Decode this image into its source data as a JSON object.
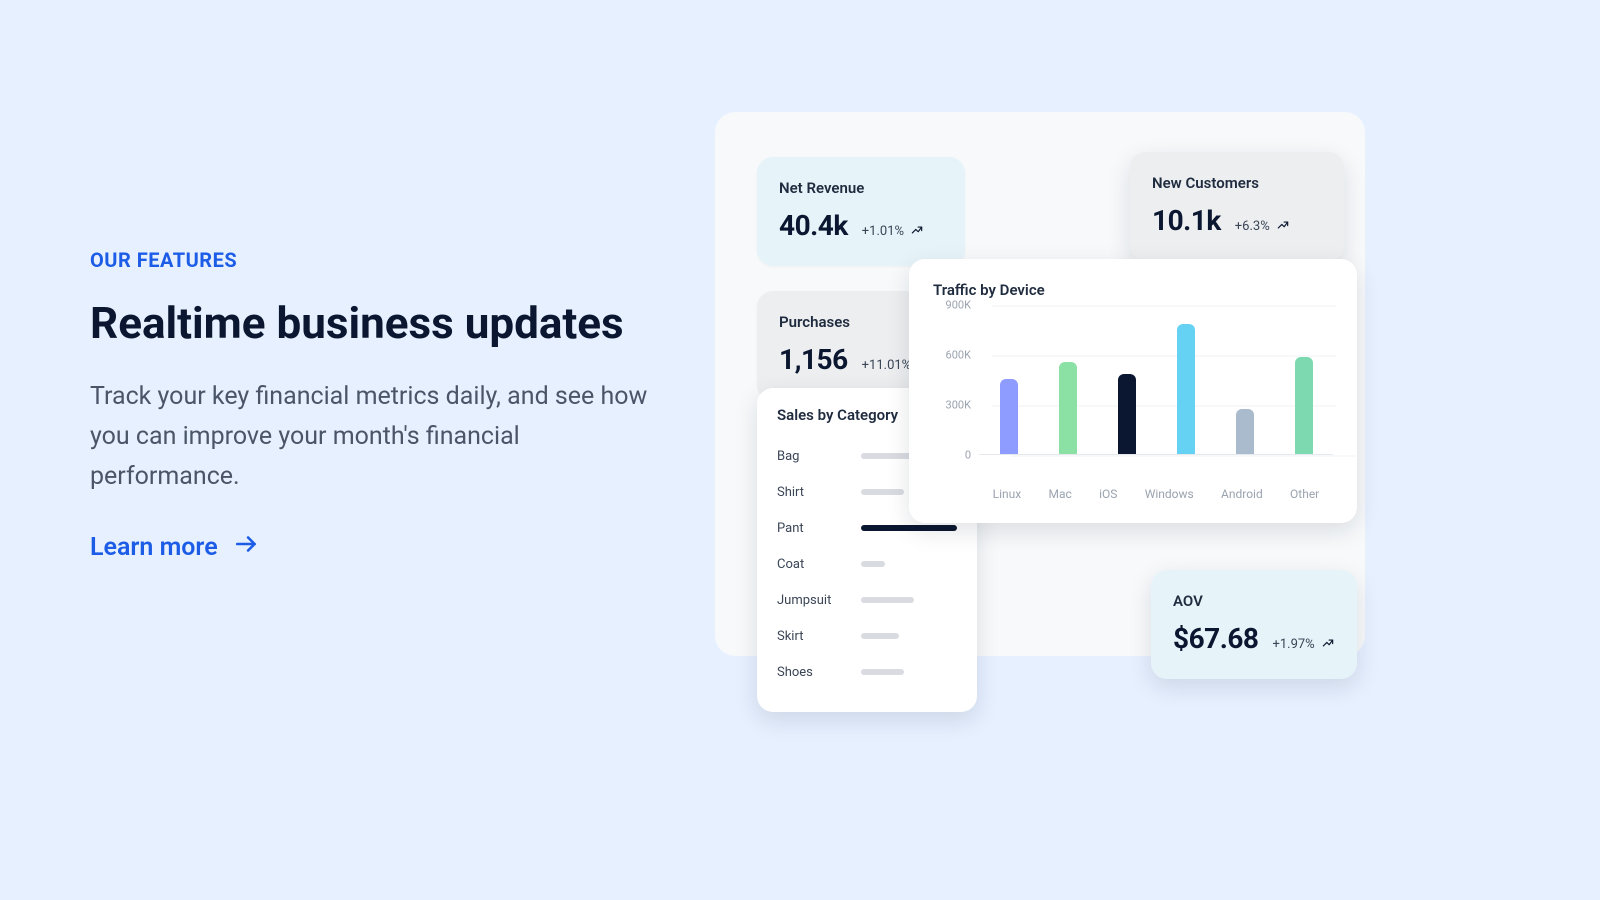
{
  "left": {
    "eyebrow": "OUR FEATURES",
    "headline": "Realtime business updates",
    "body": "Track your key financial metrics daily, and see how you can improve your month's financial performance.",
    "cta": "Learn more"
  },
  "colors": {
    "accent": "#1C5CE6",
    "page_bg": "#E6F0FF",
    "panel_bg": "#F7F9FB",
    "card_cyan": "#E6F4F9",
    "card_gray": "#ECEEF0"
  },
  "kpis": {
    "net_revenue": {
      "label": "Net Revenue",
      "value": "40.4k",
      "change": "+1.01%"
    },
    "new_customers": {
      "label": "New Customers",
      "value": "10.1k",
      "change": "+6.3%"
    },
    "purchases": {
      "label": "Purchases",
      "value": "1,156",
      "change": "+11.01%"
    },
    "aov": {
      "label": "AOV",
      "value": "$67.68",
      "change": "+1.97%"
    }
  },
  "sales_by_category": {
    "title": "Sales by Category",
    "items": [
      {
        "label": "Bag",
        "pct": 60,
        "highlight": false
      },
      {
        "label": "Shirt",
        "pct": 45,
        "highlight": false
      },
      {
        "label": "Pant",
        "pct": 100,
        "highlight": true
      },
      {
        "label": "Coat",
        "pct": 25,
        "highlight": false
      },
      {
        "label": "Jumpsuit",
        "pct": 55,
        "highlight": false
      },
      {
        "label": "Skirt",
        "pct": 40,
        "highlight": false
      },
      {
        "label": "Shoes",
        "pct": 45,
        "highlight": false
      }
    ]
  },
  "chart_data": {
    "type": "bar",
    "title": "Traffic by Device",
    "ylabel": "",
    "xlabel": "",
    "ylim": [
      0,
      900000
    ],
    "y_ticks": [
      "900K",
      "600K",
      "300K",
      "0"
    ],
    "categories": [
      "Linux",
      "Mac",
      "iOS",
      "Windows",
      "Android",
      "Other"
    ],
    "values": [
      450000,
      550000,
      480000,
      780000,
      270000,
      580000
    ],
    "colors": [
      "#8E9BFF",
      "#8BE0A4",
      "#0B1730",
      "#65D1F3",
      "#A9BBCC",
      "#7CD9B0"
    ]
  }
}
